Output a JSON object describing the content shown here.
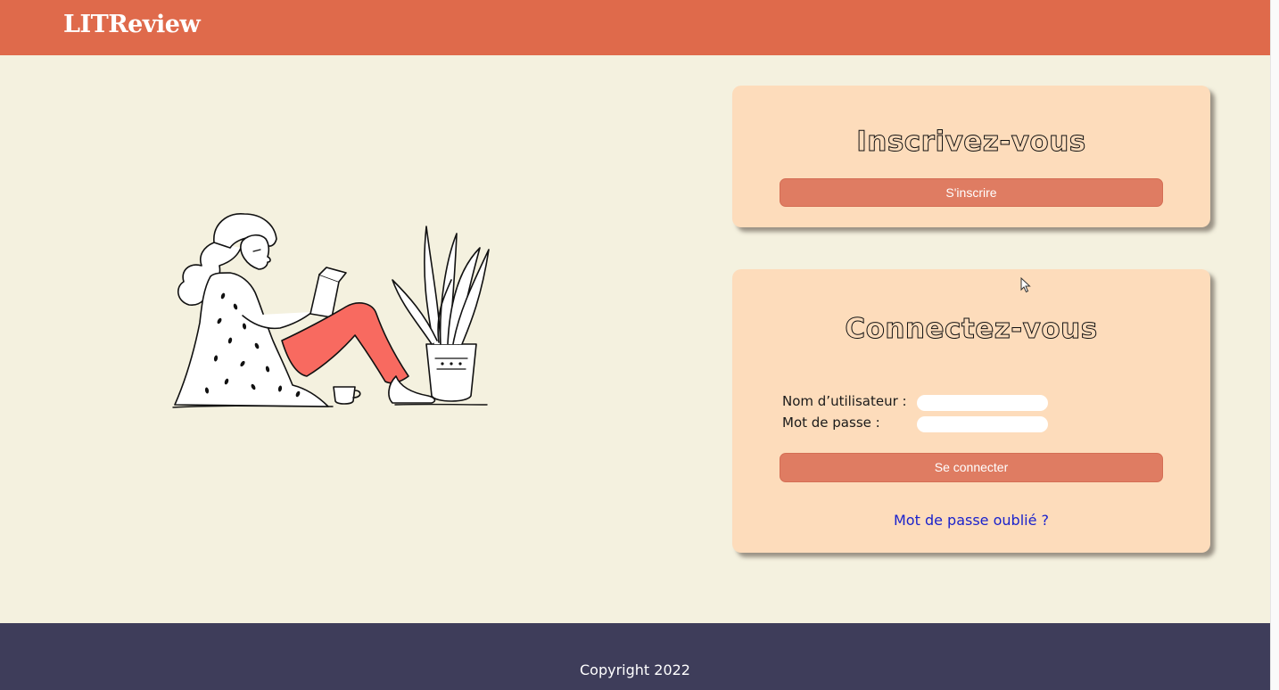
{
  "header": {
    "brand": "LITReview"
  },
  "signup": {
    "title": "Inscrivez-vous",
    "button_label": "S'inscrire"
  },
  "login": {
    "title": "Connectez-vous",
    "username_label": "Nom d’utilisateur :",
    "username_value": "",
    "password_label": "Mot de passe :",
    "password_value": "",
    "button_label": "Se connecter",
    "forgot_link": "Mot de passe oublié ?"
  },
  "footer": {
    "copyright": "Copyright 2022"
  },
  "illustration": {
    "icon": "woman-reading-with-plant-illustration"
  },
  "colors": {
    "header": "#df6a4b",
    "background": "#f4f1df",
    "card": "#fddcbb",
    "button": "#df7c62",
    "footer": "#3e3d5a",
    "link": "#1a22cc",
    "pants": "#f86a60"
  }
}
